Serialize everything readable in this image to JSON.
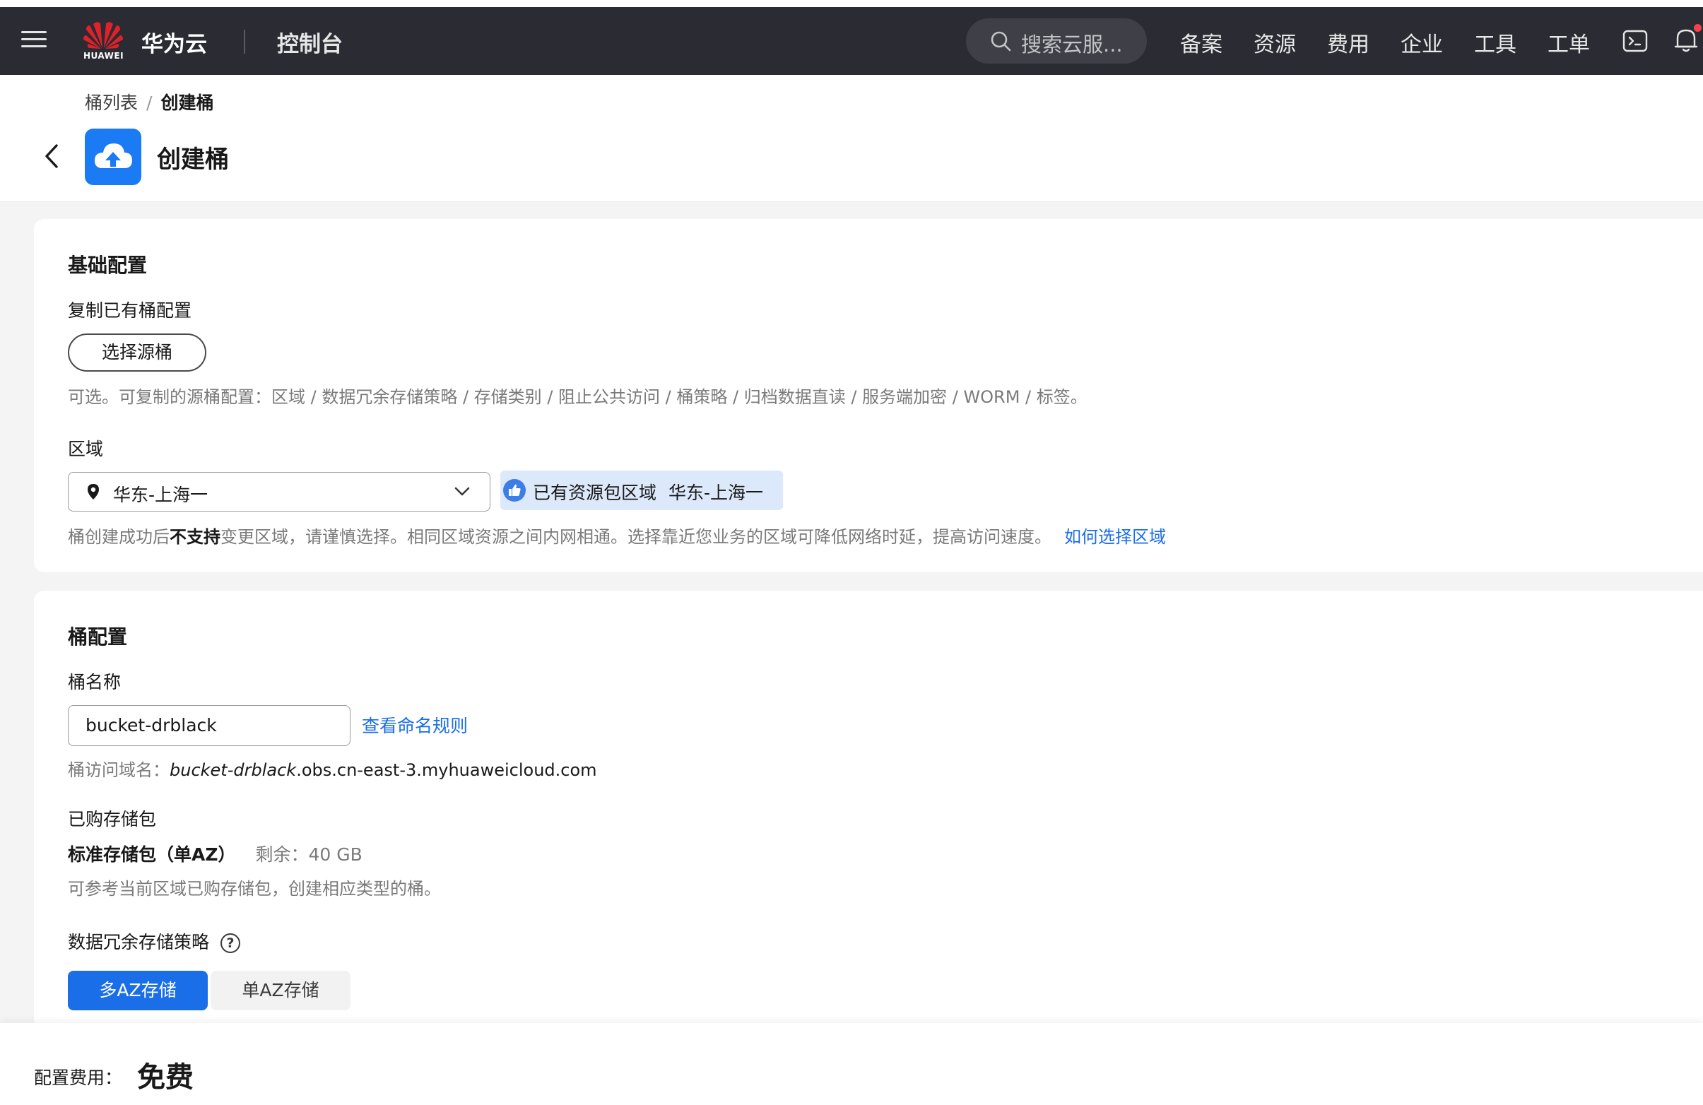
{
  "topbar": {
    "logo_text": "HUAWEI",
    "brand": "华为云",
    "console": "控制台",
    "search_placeholder": "搜索云服...",
    "nav": [
      "备案",
      "资源",
      "费用",
      "企业",
      "工具",
      "工单"
    ],
    "colors": {
      "bg": "#2b2c33",
      "notification_dot": "#f5424b"
    }
  },
  "breadcrumb": {
    "parent": "桶列表",
    "separator": "/",
    "current": "创建桶"
  },
  "page": {
    "title": "创建桶",
    "icon": "cloud-upload-icon",
    "accent": "#1a7bf5"
  },
  "basic": {
    "title": "基础配置",
    "copy_label": "复制已有桶配置",
    "copy_button": "选择源桶",
    "copy_hint": "可选。可复制的源桶配置：区域 / 数据冗余存储策略 / 存储类别 / 阻止公共访问 / 桶策略 / 归档数据直读 / 服务端加密 / WORM / 标签。",
    "region_label": "区域",
    "region_value": "华东-上海一",
    "region_tag_label": "已有资源包区域",
    "region_tag_value": "华东-上海一",
    "region_hint_pre": "桶创建成功后",
    "region_hint_bold": "不支持",
    "region_hint_post": "变更区域，请谨慎选择。相同区域资源之间内网相通。选择靠近您业务的区域可降低网络时延，提高访问速度。",
    "region_link": "如何选择区域"
  },
  "bucket": {
    "title": "桶配置",
    "name_label": "桶名称",
    "name_value": "bucket-drblack",
    "naming_link": "查看命名规则",
    "domain_label": "桶访问域名：",
    "domain_name": "bucket-drblack",
    "domain_suffix": ".obs.cn-east-3.myhuaweicloud.com",
    "purchased_label": "已购存储包",
    "package_name": "标准存储包（单AZ）",
    "package_remaining": "剩余：40 GB",
    "package_hint": "可参考当前区域已购存储包，创建相应类型的桶。",
    "redundancy_label": "数据冗余存储策略",
    "help_glyph": "?",
    "options": [
      "多AZ存储",
      "单AZ存储"
    ],
    "selected_option": "多AZ存储"
  },
  "footer": {
    "fee_label": "配置费用：",
    "fee_value": "免费"
  }
}
